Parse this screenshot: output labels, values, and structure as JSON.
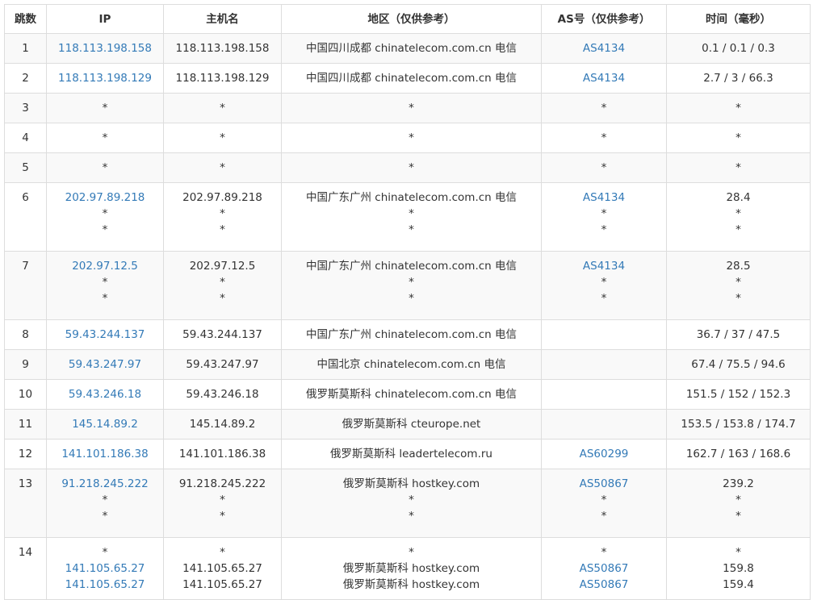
{
  "headers": {
    "hop": "跳数",
    "ip": "IP",
    "host": "主机名",
    "location": "地区（仅供参考）",
    "as": "AS号（仅供参考）",
    "time": "时间（毫秒）"
  },
  "rows": [
    {
      "hop": "1",
      "ip": [
        "118.113.198.158"
      ],
      "host": [
        "118.113.198.158"
      ],
      "loc": [
        "中国四川成都 chinatelecom.com.cn 电信"
      ],
      "as": [
        "AS4134"
      ],
      "time": [
        "0.1 / 0.1 / 0.3"
      ]
    },
    {
      "hop": "2",
      "ip": [
        "118.113.198.129"
      ],
      "host": [
        "118.113.198.129"
      ],
      "loc": [
        "中国四川成都 chinatelecom.com.cn 电信"
      ],
      "as": [
        "AS4134"
      ],
      "time": [
        "2.7 / 3 / 66.3"
      ]
    },
    {
      "hop": "3",
      "ip": [
        "*"
      ],
      "host": [
        "*"
      ],
      "loc": [
        "*"
      ],
      "as": [
        "*"
      ],
      "time": [
        "*"
      ]
    },
    {
      "hop": "4",
      "ip": [
        "*"
      ],
      "host": [
        "*"
      ],
      "loc": [
        "*"
      ],
      "as": [
        "*"
      ],
      "time": [
        "*"
      ]
    },
    {
      "hop": "5",
      "ip": [
        "*"
      ],
      "host": [
        "*"
      ],
      "loc": [
        "*"
      ],
      "as": [
        "*"
      ],
      "time": [
        "*"
      ]
    },
    {
      "hop": "6",
      "ip": [
        "202.97.89.218",
        "*",
        "*"
      ],
      "host": [
        "202.97.89.218",
        "*",
        "*"
      ],
      "loc": [
        "中国广东广州 chinatelecom.com.cn 电信",
        "*",
        "*"
      ],
      "as": [
        "AS4134",
        "*",
        "*"
      ],
      "time": [
        "28.4",
        "*",
        "*"
      ]
    },
    {
      "hop": "7",
      "ip": [
        "202.97.12.5",
        "*",
        "*"
      ],
      "host": [
        "202.97.12.5",
        "*",
        "*"
      ],
      "loc": [
        "中国广东广州 chinatelecom.com.cn 电信",
        "*",
        "*"
      ],
      "as": [
        "AS4134",
        "*",
        "*"
      ],
      "time": [
        "28.5",
        "*",
        "*"
      ]
    },
    {
      "hop": "8",
      "ip": [
        "59.43.244.137"
      ],
      "host": [
        "59.43.244.137"
      ],
      "loc": [
        "中国广东广州 chinatelecom.com.cn 电信"
      ],
      "as": [
        ""
      ],
      "time": [
        "36.7 / 37 / 47.5"
      ]
    },
    {
      "hop": "9",
      "ip": [
        "59.43.247.97"
      ],
      "host": [
        "59.43.247.97"
      ],
      "loc": [
        "中国北京 chinatelecom.com.cn 电信"
      ],
      "as": [
        ""
      ],
      "time": [
        "67.4 / 75.5 / 94.6"
      ]
    },
    {
      "hop": "10",
      "ip": [
        "59.43.246.18"
      ],
      "host": [
        "59.43.246.18"
      ],
      "loc": [
        "俄罗斯莫斯科 chinatelecom.com.cn 电信"
      ],
      "as": [
        ""
      ],
      "time": [
        "151.5 / 152 / 152.3"
      ]
    },
    {
      "hop": "11",
      "ip": [
        "145.14.89.2"
      ],
      "host": [
        "145.14.89.2"
      ],
      "loc": [
        "俄罗斯莫斯科 cteurope.net"
      ],
      "as": [
        ""
      ],
      "time": [
        "153.5 / 153.8 / 174.7"
      ]
    },
    {
      "hop": "12",
      "ip": [
        "141.101.186.38"
      ],
      "host": [
        "141.101.186.38"
      ],
      "loc": [
        "俄罗斯莫斯科 leadertelecom.ru"
      ],
      "as": [
        "AS60299"
      ],
      "time": [
        "162.7 / 163 / 168.6"
      ]
    },
    {
      "hop": "13",
      "ip": [
        "91.218.245.222",
        "*",
        "*"
      ],
      "host": [
        "91.218.245.222",
        "*",
        "*"
      ],
      "loc": [
        "俄罗斯莫斯科 hostkey.com",
        "*",
        "*"
      ],
      "as": [
        "AS50867",
        "*",
        "*"
      ],
      "time": [
        "239.2",
        "*",
        "*"
      ]
    },
    {
      "hop": "14",
      "ip": [
        "*",
        "141.105.65.27",
        "141.105.65.27"
      ],
      "host": [
        "*",
        "141.105.65.27",
        "141.105.65.27"
      ],
      "loc": [
        "*",
        "俄罗斯莫斯科 hostkey.com",
        "俄罗斯莫斯科 hostkey.com"
      ],
      "as": [
        "*",
        "AS50867",
        "AS50867"
      ],
      "time": [
        "*",
        "159.8",
        "159.4"
      ]
    }
  ],
  "colors": {
    "link": "#337ab7",
    "text": "#333333",
    "border": "#dddddd",
    "stripe": "#f9f9f9"
  }
}
